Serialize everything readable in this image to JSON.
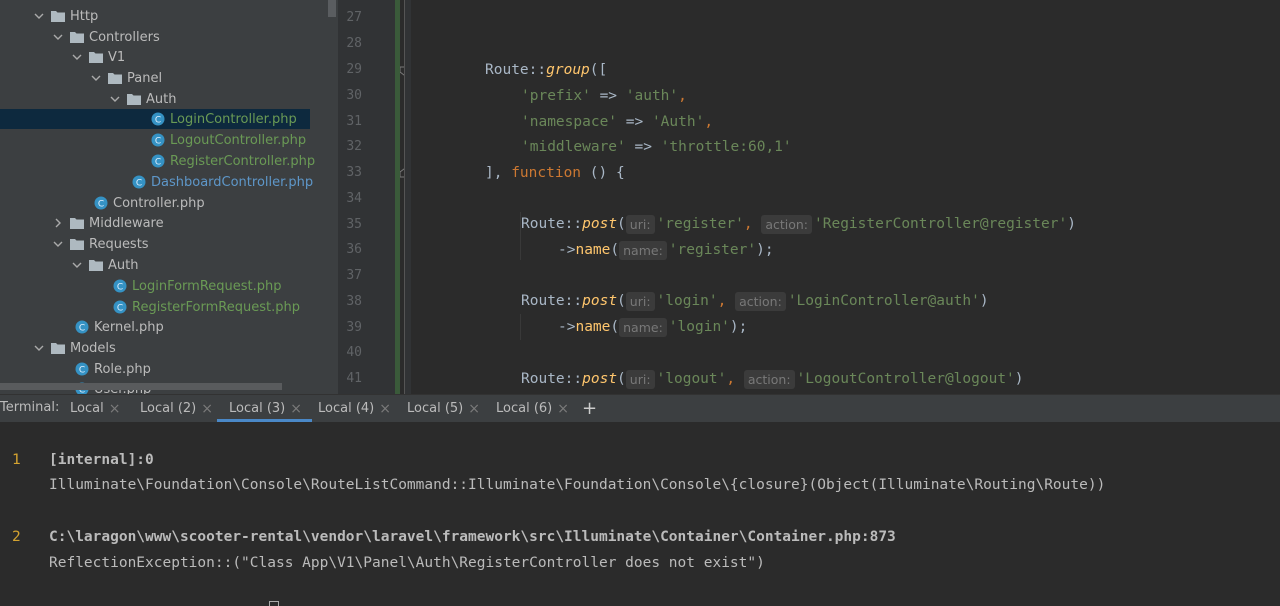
{
  "tree": [
    {
      "label": "Http",
      "kind": "folder",
      "expanded": true,
      "color": "normal"
    },
    {
      "label": "Controllers",
      "kind": "folder",
      "expanded": true,
      "color": "normal"
    },
    {
      "label": "V1",
      "kind": "folder",
      "expanded": true,
      "color": "normal"
    },
    {
      "label": "Panel",
      "kind": "folder",
      "expanded": true,
      "color": "normal"
    },
    {
      "label": "Auth",
      "kind": "folder",
      "expanded": true,
      "color": "normal"
    },
    {
      "label": "LoginController.php",
      "kind": "class",
      "color": "green",
      "selected": true
    },
    {
      "label": "LogoutController.php",
      "kind": "class",
      "color": "green"
    },
    {
      "label": "RegisterController.php",
      "kind": "class",
      "color": "green"
    },
    {
      "label": "DashboardController.php",
      "kind": "class",
      "color": "blue"
    },
    {
      "label": "Controller.php",
      "kind": "class",
      "color": "normal"
    },
    {
      "label": "Middleware",
      "kind": "folder",
      "expanded": false,
      "color": "normal"
    },
    {
      "label": "Requests",
      "kind": "folder",
      "expanded": true,
      "color": "normal"
    },
    {
      "label": "Auth",
      "kind": "folder",
      "expanded": true,
      "color": "normal"
    },
    {
      "label": "LoginFormRequest.php",
      "kind": "class",
      "color": "green"
    },
    {
      "label": "RegisterFormRequest.php",
      "kind": "class",
      "color": "green"
    },
    {
      "label": "Kernel.php",
      "kind": "class",
      "color": "normal"
    },
    {
      "label": "Models",
      "kind": "folder",
      "expanded": true,
      "color": "normal"
    },
    {
      "label": "Role.php",
      "kind": "class",
      "color": "normal"
    },
    {
      "label": "User.php",
      "kind": "class",
      "color": "normal"
    }
  ],
  "editor": {
    "line_numbers": [
      "27",
      "28",
      "29",
      "30",
      "31",
      "32",
      "33",
      "34",
      "35",
      "36",
      "37",
      "38",
      "39",
      "40",
      "41"
    ],
    "l29": {
      "cls": "Route",
      "sep": "::",
      "fn": "group",
      "rest": "(["
    },
    "l30": {
      "key": "'prefix'",
      "arrow": " => ",
      "val": "'auth'",
      "end": ","
    },
    "l31": {
      "key": "'namespace'",
      "arrow": " => ",
      "val": "'Auth'",
      "end": ","
    },
    "l32": {
      "key": "'middleware'",
      "arrow": " => ",
      "val": "'throttle:60,1'"
    },
    "l33": {
      "start": "], ",
      "kw": "function",
      "end": " () {"
    },
    "l35": {
      "cls": "Route",
      "sep": "::",
      "fn": "post",
      "open": "(",
      "hint1": "uri:",
      "arg1": "'register'",
      "comma": ",",
      "hint2": "action:",
      "arg2": "'RegisterController@register'",
      "close": ")"
    },
    "l36": {
      "arrow": "->",
      "fn": "name",
      "open": "(",
      "hint": "name:",
      "arg": "'register'",
      "close": ");"
    },
    "l38": {
      "cls": "Route",
      "sep": "::",
      "fn": "post",
      "open": "(",
      "hint1": "uri:",
      "arg1": "'login'",
      "comma": ",",
      "hint2": "action:",
      "arg2": "'LoginController@auth'",
      "close": ")"
    },
    "l39": {
      "arrow": "->",
      "fn": "name",
      "open": "(",
      "hint": "name:",
      "arg": "'login'",
      "close": ");"
    },
    "l41": {
      "cls": "Route",
      "sep": "::",
      "fn": "post",
      "open": "(",
      "hint1": "uri:",
      "arg1": "'logout'",
      "comma": ",",
      "hint2": "action:",
      "arg2": "'LogoutController@logout'",
      "close": ")"
    }
  },
  "terminal": {
    "title": "Terminal:",
    "tabs": [
      "Local",
      "Local (2)",
      "Local (3)",
      "Local (4)",
      "Local (5)",
      "Local (6)"
    ],
    "active_tab": "Local (3)",
    "add_label": "+",
    "entries": [
      {
        "num": "1",
        "head": "[internal]:0",
        "body": "Illuminate\\Foundation\\Console\\RouteListCommand::Illuminate\\Foundation\\Console\\{closure}(Object(Illuminate\\Routing\\Route))"
      },
      {
        "num": "2",
        "head": "C:\\laragon\\www\\scooter-rental\\vendor\\laravel\\framework\\src\\Illuminate\\Container\\Container.php:873",
        "body": "ReflectionException::(\"Class App\\V1\\Panel\\Auth\\RegisterController does not exist\")"
      }
    ]
  },
  "colors": {
    "string": "#6a8759",
    "keyword": "#cc7832",
    "function": "#ffc66d",
    "green_file": "#6a9a55",
    "blue_file": "#5e97c9",
    "line_number_highlight": "#d4a330"
  }
}
